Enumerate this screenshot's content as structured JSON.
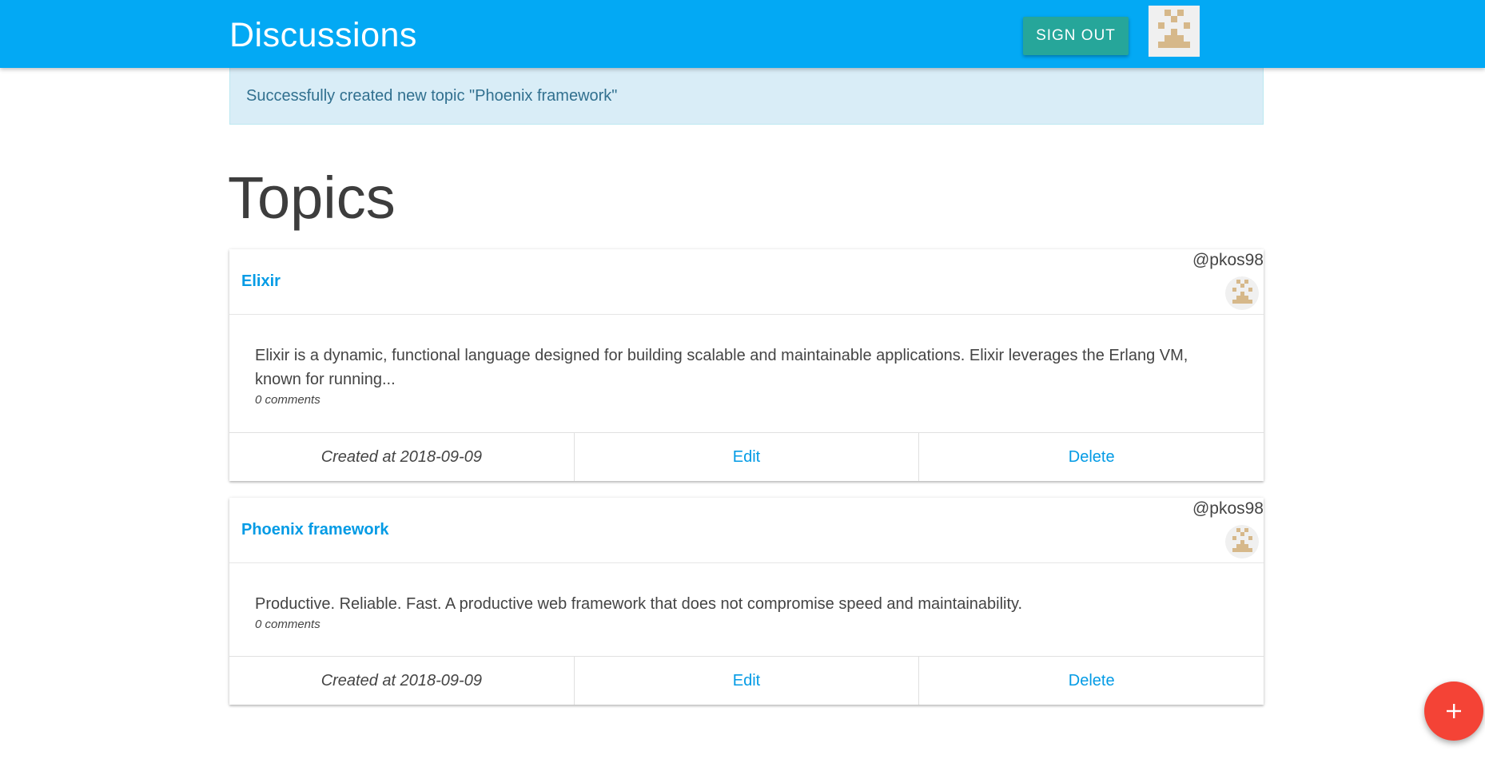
{
  "header": {
    "brand": "Discussions",
    "sign_out_label": "SIGN OUT",
    "avatar_icon": "identicon-avatar-icon"
  },
  "flash": {
    "message": "Successfully created new topic \"Phoenix framework\""
  },
  "page": {
    "title": "Topics"
  },
  "topics": [
    {
      "title": "Elixir",
      "user": "@pkos98",
      "description": "Elixir is a dynamic, functional language designed for building scalable and maintainable applications. Elixir leverages the Erlang VM, known for running...",
      "comments": "0 comments",
      "created": "Created at 2018-09-09",
      "edit_label": "Edit",
      "delete_label": "Delete"
    },
    {
      "title": "Phoenix framework",
      "user": "@pkos98",
      "description": "Productive. Reliable. Fast. A productive web framework that does not compromise speed and maintainability.",
      "comments": "0 comments",
      "created": "Created at 2018-09-09",
      "edit_label": "Edit",
      "delete_label": "Delete"
    }
  ],
  "fab": {
    "icon": "plus-icon"
  },
  "colors": {
    "appbar": "#03a9f4",
    "sign_out": "#26a69a",
    "flash_bg": "#d9edf7",
    "link": "#039be5",
    "fab": "#f44336",
    "identicon": "#d6b88a"
  }
}
